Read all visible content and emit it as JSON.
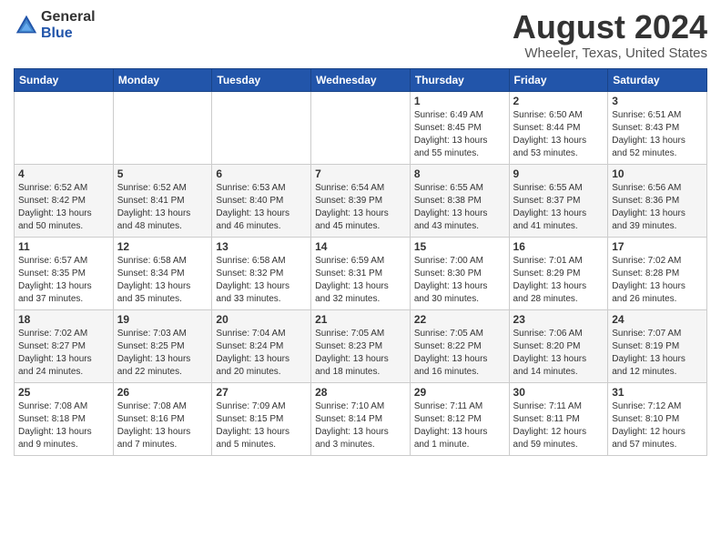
{
  "logo": {
    "general": "General",
    "blue": "Blue"
  },
  "title": "August 2024",
  "location": "Wheeler, Texas, United States",
  "days_of_week": [
    "Sunday",
    "Monday",
    "Tuesday",
    "Wednesday",
    "Thursday",
    "Friday",
    "Saturday"
  ],
  "weeks": [
    [
      {
        "day": "",
        "info": ""
      },
      {
        "day": "",
        "info": ""
      },
      {
        "day": "",
        "info": ""
      },
      {
        "day": "",
        "info": ""
      },
      {
        "day": "1",
        "info": "Sunrise: 6:49 AM\nSunset: 8:45 PM\nDaylight: 13 hours\nand 55 minutes."
      },
      {
        "day": "2",
        "info": "Sunrise: 6:50 AM\nSunset: 8:44 PM\nDaylight: 13 hours\nand 53 minutes."
      },
      {
        "day": "3",
        "info": "Sunrise: 6:51 AM\nSunset: 8:43 PM\nDaylight: 13 hours\nand 52 minutes."
      }
    ],
    [
      {
        "day": "4",
        "info": "Sunrise: 6:52 AM\nSunset: 8:42 PM\nDaylight: 13 hours\nand 50 minutes."
      },
      {
        "day": "5",
        "info": "Sunrise: 6:52 AM\nSunset: 8:41 PM\nDaylight: 13 hours\nand 48 minutes."
      },
      {
        "day": "6",
        "info": "Sunrise: 6:53 AM\nSunset: 8:40 PM\nDaylight: 13 hours\nand 46 minutes."
      },
      {
        "day": "7",
        "info": "Sunrise: 6:54 AM\nSunset: 8:39 PM\nDaylight: 13 hours\nand 45 minutes."
      },
      {
        "day": "8",
        "info": "Sunrise: 6:55 AM\nSunset: 8:38 PM\nDaylight: 13 hours\nand 43 minutes."
      },
      {
        "day": "9",
        "info": "Sunrise: 6:55 AM\nSunset: 8:37 PM\nDaylight: 13 hours\nand 41 minutes."
      },
      {
        "day": "10",
        "info": "Sunrise: 6:56 AM\nSunset: 8:36 PM\nDaylight: 13 hours\nand 39 minutes."
      }
    ],
    [
      {
        "day": "11",
        "info": "Sunrise: 6:57 AM\nSunset: 8:35 PM\nDaylight: 13 hours\nand 37 minutes."
      },
      {
        "day": "12",
        "info": "Sunrise: 6:58 AM\nSunset: 8:34 PM\nDaylight: 13 hours\nand 35 minutes."
      },
      {
        "day": "13",
        "info": "Sunrise: 6:58 AM\nSunset: 8:32 PM\nDaylight: 13 hours\nand 33 minutes."
      },
      {
        "day": "14",
        "info": "Sunrise: 6:59 AM\nSunset: 8:31 PM\nDaylight: 13 hours\nand 32 minutes."
      },
      {
        "day": "15",
        "info": "Sunrise: 7:00 AM\nSunset: 8:30 PM\nDaylight: 13 hours\nand 30 minutes."
      },
      {
        "day": "16",
        "info": "Sunrise: 7:01 AM\nSunset: 8:29 PM\nDaylight: 13 hours\nand 28 minutes."
      },
      {
        "day": "17",
        "info": "Sunrise: 7:02 AM\nSunset: 8:28 PM\nDaylight: 13 hours\nand 26 minutes."
      }
    ],
    [
      {
        "day": "18",
        "info": "Sunrise: 7:02 AM\nSunset: 8:27 PM\nDaylight: 13 hours\nand 24 minutes."
      },
      {
        "day": "19",
        "info": "Sunrise: 7:03 AM\nSunset: 8:25 PM\nDaylight: 13 hours\nand 22 minutes."
      },
      {
        "day": "20",
        "info": "Sunrise: 7:04 AM\nSunset: 8:24 PM\nDaylight: 13 hours\nand 20 minutes."
      },
      {
        "day": "21",
        "info": "Sunrise: 7:05 AM\nSunset: 8:23 PM\nDaylight: 13 hours\nand 18 minutes."
      },
      {
        "day": "22",
        "info": "Sunrise: 7:05 AM\nSunset: 8:22 PM\nDaylight: 13 hours\nand 16 minutes."
      },
      {
        "day": "23",
        "info": "Sunrise: 7:06 AM\nSunset: 8:20 PM\nDaylight: 13 hours\nand 14 minutes."
      },
      {
        "day": "24",
        "info": "Sunrise: 7:07 AM\nSunset: 8:19 PM\nDaylight: 13 hours\nand 12 minutes."
      }
    ],
    [
      {
        "day": "25",
        "info": "Sunrise: 7:08 AM\nSunset: 8:18 PM\nDaylight: 13 hours\nand 9 minutes."
      },
      {
        "day": "26",
        "info": "Sunrise: 7:08 AM\nSunset: 8:16 PM\nDaylight: 13 hours\nand 7 minutes."
      },
      {
        "day": "27",
        "info": "Sunrise: 7:09 AM\nSunset: 8:15 PM\nDaylight: 13 hours\nand 5 minutes."
      },
      {
        "day": "28",
        "info": "Sunrise: 7:10 AM\nSunset: 8:14 PM\nDaylight: 13 hours\nand 3 minutes."
      },
      {
        "day": "29",
        "info": "Sunrise: 7:11 AM\nSunset: 8:12 PM\nDaylight: 13 hours\nand 1 minute."
      },
      {
        "day": "30",
        "info": "Sunrise: 7:11 AM\nSunset: 8:11 PM\nDaylight: 12 hours\nand 59 minutes."
      },
      {
        "day": "31",
        "info": "Sunrise: 7:12 AM\nSunset: 8:10 PM\nDaylight: 12 hours\nand 57 minutes."
      }
    ]
  ]
}
